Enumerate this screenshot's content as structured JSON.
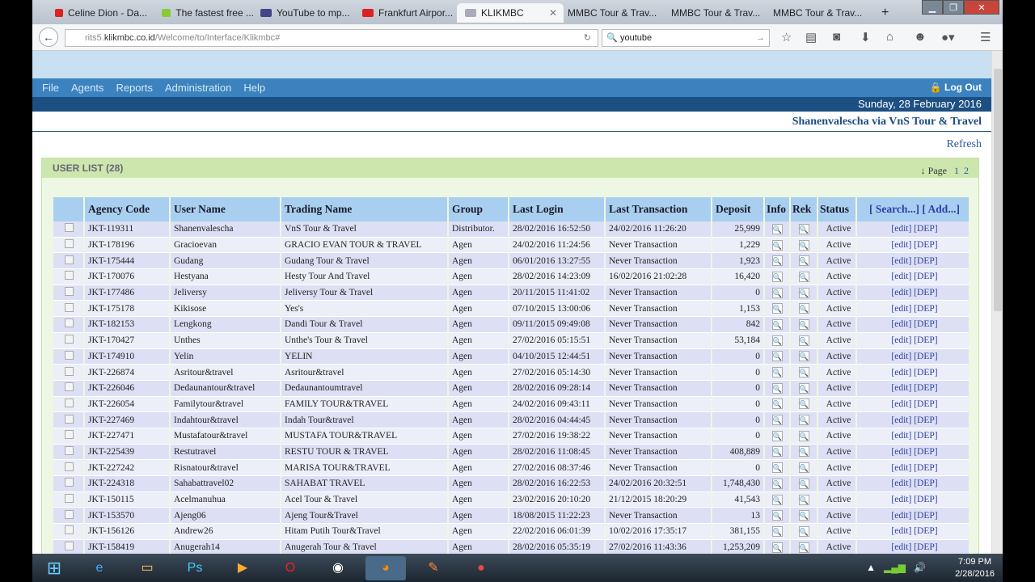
{
  "browser": {
    "tabs": [
      {
        "label": "Celine Dion - Da...",
        "icon": "youtube-icon",
        "color": "#d22"
      },
      {
        "label": "The fastest free ...",
        "icon": "download-icon",
        "color": "#8c3"
      },
      {
        "label": "YouTube to mp...",
        "icon": "mp3-icon",
        "color": "#448"
      },
      {
        "label": "Frankfurt Airpor...",
        "icon": "youtube-icon",
        "color": "#d22"
      },
      {
        "label": "KLIKMBC",
        "icon": "klikmbc-icon",
        "color": "#aab",
        "active": true
      },
      {
        "label": "MMBC Tour & Trav..."
      },
      {
        "label": "MMBC Tour & Trav..."
      },
      {
        "label": "MMBC Tour & Trav..."
      }
    ],
    "url_prefix": "rits5.",
    "url_domain": "klikmbc.co.id",
    "url_path": "/Welcome/to/Interface/Klikmbc#",
    "search_value": "youtube"
  },
  "header": {
    "menu": [
      "File",
      "Agents",
      "Reports",
      "Administration",
      "Help"
    ],
    "logout": "Log Out",
    "date": "Sunday, 28 February 2016",
    "user": "Shanenvalescha via VnS Tour & Travel",
    "refresh": "Refresh"
  },
  "panel": {
    "title": "USER LIST (28)",
    "page_label": "Page",
    "pages": [
      "1",
      "2"
    ],
    "columns": [
      "",
      "Agency Code",
      "User Name",
      "Trading Name",
      "Group",
      "Last Login",
      "Last Transaction",
      "Deposit",
      "Info",
      "Rek",
      "Status"
    ],
    "search_link": "[ Search...]",
    "add_link": "[ Add...]",
    "edit_label": "[edit]",
    "dep_label": "[DEP]",
    "rows": [
      [
        "JKT-119311",
        "Shanenvalescha",
        "VnS Tour & Travel",
        "Distributor.",
        "28/02/2016 16:52:50",
        "24/02/2016 11:26:20",
        "25,999",
        "Active"
      ],
      [
        "JKT-178196",
        "Gracioevan",
        "GRACIO EVAN TOUR & TRAVEL",
        "Agen",
        "24/02/2016 11:24:56",
        "Never Transaction",
        "1,229",
        "Active"
      ],
      [
        "JKT-175444",
        "Gudang",
        "Gudang Tour & Travel",
        "Agen",
        "06/01/2016 13:27:55",
        "Never Transaction",
        "1,923",
        "Active"
      ],
      [
        "JKT-170076",
        "Hestyana",
        "Hesty Tour And Travel",
        "Agen",
        "28/02/2016 14:23:09",
        "16/02/2016 21:02:28",
        "16,420",
        "Active"
      ],
      [
        "JKT-177486",
        "Jeliversy",
        "Jeliversy Tour & Travel",
        "Agen",
        "20/11/2015 11:41:02",
        "Never Transaction",
        "0",
        "Active"
      ],
      [
        "JKT-175178",
        "Kikisose",
        "Yes's",
        "Agen",
        "07/10/2015 13:00:06",
        "Never Transaction",
        "1,153",
        "Active"
      ],
      [
        "JKT-182153",
        "Lengkong",
        "Dandi Tour & Travel",
        "Agen",
        "09/11/2015 09:49:08",
        "Never Transaction",
        "842",
        "Active"
      ],
      [
        "JKT-170427",
        "Unthes",
        "Unthe's Tour & Travel",
        "Agen",
        "27/02/2016 05:15:51",
        "Never Transaction",
        "53,184",
        "Active"
      ],
      [
        "JKT-174910",
        "Yelin",
        "YELIN",
        "Agen",
        "04/10/2015 12:44:51",
        "Never Transaction",
        "0",
        "Active"
      ],
      [
        "JKT-226874",
        "Asritour&travel",
        "Asritour&travel",
        "Agen",
        "27/02/2016 05:14:30",
        "Never Transaction",
        "0",
        "Active"
      ],
      [
        "JKT-226046",
        "Dedaunantour&travel",
        "Dedaunantoumtravel",
        "Agen",
        "28/02/2016 09:28:14",
        "Never Transaction",
        "0",
        "Active"
      ],
      [
        "JKT-226054",
        "Familytour&travel",
        "FAMILY TOUR&TRAVEL",
        "Agen",
        "24/02/2016 09:43:11",
        "Never Transaction",
        "0",
        "Active"
      ],
      [
        "JKT-227469",
        "Indahtour&travel",
        "Indah Tour&travel",
        "Agen",
        "28/02/2016 04:44:45",
        "Never Transaction",
        "0",
        "Active"
      ],
      [
        "JKT-227471",
        "Mustafatour&travel",
        "MUSTAFA TOUR&TRAVEL",
        "Agen",
        "27/02/2016 19:38:22",
        "Never Transaction",
        "0",
        "Active"
      ],
      [
        "JKT-225439",
        "Restutravel",
        "RESTU TOUR & TRAVEL",
        "Agen",
        "28/02/2016 11:08:45",
        "Never Transaction",
        "408,889",
        "Active"
      ],
      [
        "JKT-227242",
        "Risnatour&travel",
        "MARISA TOUR&TRAVEL",
        "Agen",
        "27/02/2016 08:37:46",
        "Never Transaction",
        "0",
        "Active"
      ],
      [
        "JKT-224318",
        "Sahabattravel02",
        "SAHABAT TRAVEL",
        "Agen",
        "28/02/2016 16:22:53",
        "24/02/2016 20:32:51",
        "1,748,430",
        "Active"
      ],
      [
        "JKT-150115",
        "Acelmanuhua",
        "Acel Tour & Travel",
        "Agen",
        "23/02/2016 20:10:20",
        "21/12/2015 18:20:29",
        "41,543",
        "Active"
      ],
      [
        "JKT-153570",
        "Ajeng06",
        "Ajeng Tour&Travel",
        "Agen",
        "18/08/2015 11:22:23",
        "Never Transaction",
        "13",
        "Active"
      ],
      [
        "JKT-156126",
        "Andrew26",
        "Hitam Putih Tour&Travel",
        "Agen",
        "22/02/2016 06:01:39",
        "10/02/2016 17:35:17",
        "381,155",
        "Active"
      ],
      [
        "JKT-158419",
        "Anugerah14",
        "Anugerah Tour & Travel",
        "Agen",
        "28/02/2016 05:35:19",
        "27/02/2016 11:43:36",
        "1,253,209",
        "Active"
      ]
    ]
  },
  "taskbar": {
    "time": "7:09 PM",
    "date": "2/28/2016"
  }
}
